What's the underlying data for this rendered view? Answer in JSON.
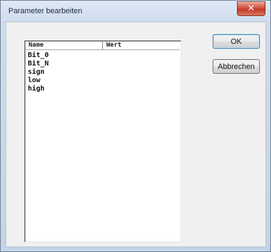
{
  "window": {
    "title": "Parameter bearbeiten",
    "close_glyph": "✕"
  },
  "list": {
    "columns": [
      "Name",
      "Wert"
    ],
    "rows": [
      {
        "name": "Bit_0",
        "value": ""
      },
      {
        "name": "Bit_N",
        "value": ""
      },
      {
        "name": "sign",
        "value": ""
      },
      {
        "name": "low",
        "value": ""
      },
      {
        "name": "high",
        "value": ""
      }
    ]
  },
  "buttons": {
    "ok_label": "OK",
    "cancel_label": "Abbrechen"
  }
}
